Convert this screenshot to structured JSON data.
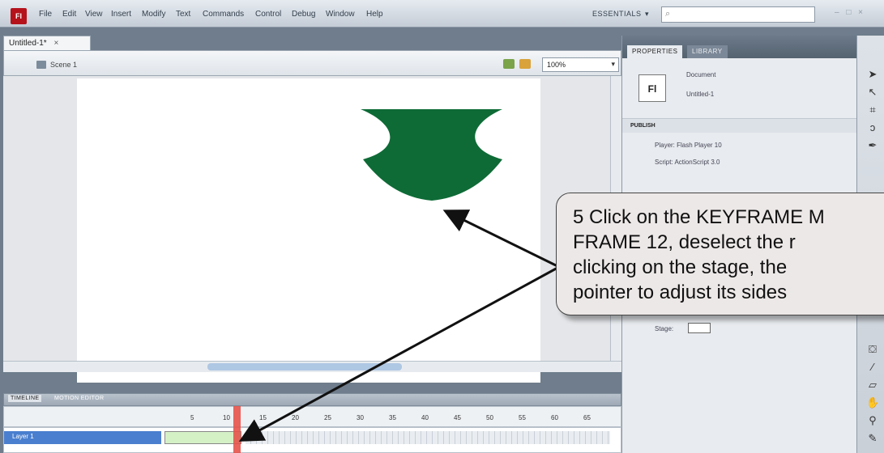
{
  "app": {
    "logo": "Fl"
  },
  "menu": [
    "File",
    "Edit",
    "View",
    "Insert",
    "Modify",
    "Text",
    "Commands",
    "Control",
    "Debug",
    "Window",
    "Help"
  ],
  "workspace": {
    "label": "ESSENTIALS",
    "arrow": "▾",
    "search_icon": "search-icon"
  },
  "window_controls": "– □ ×",
  "document": {
    "tab_label": "Untitled-1*",
    "close_label": "×",
    "scene_label": "Scene 1",
    "zoom": "100%",
    "zoom_arrow": "▾"
  },
  "timeline": {
    "tabs": [
      "TIMELINE",
      "MOTION EDITOR"
    ],
    "frame_numbers": [
      "5",
      "10",
      "15",
      "20",
      "25",
      "30",
      "35",
      "40",
      "45",
      "50",
      "55",
      "60",
      "65"
    ],
    "layer_name": "Layer 1"
  },
  "properties": {
    "tabs": [
      "PROPERTIES",
      "LIBRARY"
    ],
    "icon_text": "Fl",
    "doc_type": "Document",
    "doc_name": "Untitled-1",
    "publish_header": "PUBLISH",
    "player": "Player: Flash Player 10",
    "script": "Script: ActionScript 3.0",
    "stage_label": "Stage:"
  },
  "callout": {
    "text": "5  Click on the KEYFRAME M\n    FRAME 12, deselect the r\n    clicking on the stage, the\n    pointer to adjust its sides"
  },
  "colors": {
    "shape_fill": "#0e6b36",
    "callout_bg": "#ede8e8"
  }
}
